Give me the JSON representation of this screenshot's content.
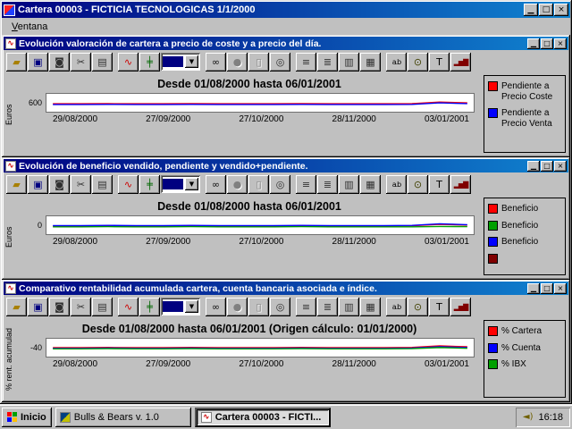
{
  "app": {
    "title": "Cartera 00003 - FICTICIA TECNOLOGICAS 1/1/2000",
    "menu": [
      {
        "label": "Ventana"
      }
    ]
  },
  "icons": {
    "minimize_glyph": "▁",
    "maximize_glyph": "□",
    "close_glyph": "×",
    "chart_window_glyph": "∿",
    "volume_glyph": "◄)",
    "dropdown_arrow_glyph": "▼"
  },
  "colors": {
    "titlebar_start": "#000080",
    "titlebar_end": "#1084d0",
    "chrome": "#c0c0c0",
    "series_red": "#ff0000",
    "series_blue": "#0000ff",
    "series_green": "#00a000"
  },
  "toolbar": {
    "buttons": [
      {
        "name": "open-button",
        "icon": "open-folder-icon",
        "glyph": "▰",
        "color": "#a88000"
      },
      {
        "name": "save-button",
        "icon": "save-floppy-icon",
        "glyph": "▣",
        "color": "#000080"
      },
      {
        "name": "snapshot-button",
        "icon": "camera-icon",
        "glyph": "◙",
        "color": "#303030"
      },
      {
        "name": "cut-button",
        "icon": "scissors-icon",
        "glyph": "✂",
        "color": "#303030"
      },
      {
        "name": "print-button",
        "icon": "printer-icon",
        "glyph": "▤",
        "color": "#303030",
        "gap": true
      },
      {
        "name": "line-chart-button",
        "icon": "line-chart-icon",
        "glyph": "∿",
        "color": "#cc0000"
      },
      {
        "name": "bar-chart-button",
        "icon": "candlestick-icon",
        "glyph": "╪",
        "color": "#006600"
      },
      {
        "type": "dropdown",
        "name": "series-selector-dropdown",
        "icon": "dropdown-arrow-icon",
        "fill": "#000080",
        "gap": true
      },
      {
        "name": "view-button",
        "icon": "glasses-icon",
        "glyph": "∞",
        "color": "#101010"
      },
      {
        "name": "pointer-button",
        "icon": "pointer-icon",
        "glyph": "●",
        "disabled": true
      },
      {
        "name": "region-button",
        "icon": "region-icon",
        "glyph": "▯",
        "disabled": true
      },
      {
        "name": "zoom-button",
        "icon": "magnifier-icon",
        "glyph": "◎",
        "color": "#303030",
        "gap": true
      },
      {
        "name": "report-list-button",
        "icon": "document-icon",
        "glyph": "≡",
        "color": "#303030"
      },
      {
        "name": "report-lines-button",
        "icon": "document-lines-icon",
        "glyph": "≣",
        "color": "#303030"
      },
      {
        "name": "report-table-button",
        "icon": "table-icon",
        "glyph": "▥",
        "color": "#303030"
      },
      {
        "name": "report-grid-button",
        "icon": "grid-icon",
        "glyph": "▦",
        "color": "#303030",
        "gap": true
      },
      {
        "name": "text-button",
        "icon": "ab-text-icon",
        "glyph": "a.b",
        "color": "#000000",
        "small": true
      },
      {
        "name": "find-button",
        "icon": "find-icon",
        "glyph": "⊙",
        "color": "#404000"
      },
      {
        "name": "title-button",
        "icon": "title-text-icon",
        "glyph": "T",
        "color": "#000000"
      },
      {
        "name": "histogram-button",
        "icon": "histogram-icon",
        "glyph": "▂▅▇",
        "color": "#800000",
        "small": true
      }
    ]
  },
  "windows": [
    {
      "title": "Evolución valoración de cartera a precio de coste y a precio del día."
    },
    {
      "title": "Evolución de beneficio vendido, pendiente y vendido+pendiente."
    },
    {
      "title": "Comparativo rentabilidad acumulada cartera, cuenta bancaria asociada e índice."
    }
  ],
  "chart_data": [
    {
      "type": "line",
      "title": "Desde 01/08/2000 hasta 06/01/2001",
      "ylabel": "Euros",
      "y_tick_label": "600",
      "ylim": [
        520,
        700
      ],
      "x_ticks": [
        "29/08/2000",
        "27/09/2000",
        "27/10/2000",
        "28/11/2000",
        "03/01/2001"
      ],
      "legend": [
        {
          "color": "#ff0000",
          "label": "Pendiente a Precio Coste"
        },
        {
          "color": "#0000ff",
          "label": "Pendiente a Precio Venta"
        }
      ],
      "series": [
        {
          "name": "Pendiente a Precio Coste",
          "color": "#ff0000",
          "values": [
            600,
            600,
            601,
            600,
            600,
            601,
            600,
            600,
            600,
            601,
            600,
            600,
            600,
            601,
            617,
            609
          ]
        },
        {
          "name": "Pendiente a Precio Venta",
          "color": "#0000ff",
          "values": [
            593,
            593,
            594,
            593,
            593,
            594,
            593,
            593,
            593,
            594,
            593,
            593,
            593,
            594,
            609,
            602
          ]
        }
      ]
    },
    {
      "type": "line",
      "title": "Desde 01/08/2000 hasta 06/01/2001",
      "ylabel": "Euros",
      "y_tick_label": "0",
      "ylim": [
        -40,
        60
      ],
      "x_ticks": [
        "29/08/2000",
        "27/09/2000",
        "27/10/2000",
        "28/11/2000",
        "03/01/2001"
      ],
      "legend": [
        {
          "color": "#ff0000",
          "label": "Beneficio"
        },
        {
          "color": "#00a000",
          "label": "Beneficio"
        },
        {
          "color": "#0000ff",
          "label": "Beneficio"
        },
        {
          "color": "#800000",
          "label": ""
        }
      ],
      "series": [
        {
          "name": "Beneficio",
          "color": "#ff0000",
          "values": [
            6,
            6,
            7,
            6,
            6,
            7,
            6,
            6,
            6,
            7,
            6,
            6,
            6,
            7,
            15,
            11
          ]
        },
        {
          "name": "Beneficio",
          "color": "#00a000",
          "values": [
            1,
            1,
            2,
            1,
            1,
            2,
            1,
            1,
            1,
            2,
            1,
            1,
            1,
            1,
            3,
            2
          ]
        },
        {
          "name": "Beneficio",
          "color": "#0000ff",
          "values": [
            8,
            8,
            9,
            8,
            8,
            9,
            8,
            8,
            8,
            9,
            8,
            8,
            8,
            9,
            18,
            13
          ]
        }
      ]
    },
    {
      "type": "line",
      "title": "Desde 01/08/2000 hasta 06/01/2001 (Origen cálculo: 01/01/2000)",
      "ylabel": "% rent. acumulad",
      "y_tick_label": "-40",
      "ylim": [
        -55,
        -25
      ],
      "x_ticks": [
        "29/08/2000",
        "27/09/2000",
        "27/10/2000",
        "28/11/2000",
        "03/01/2001"
      ],
      "legend": [
        {
          "color": "#ff0000",
          "label": "% Cartera"
        },
        {
          "color": "#0000ff",
          "label": "% Cuenta"
        },
        {
          "color": "#00a000",
          "label": "% IBX"
        }
      ],
      "series": [
        {
          "name": "% Cartera",
          "color": "#ff0000",
          "values": [
            -40,
            -40,
            -39.6,
            -40,
            -40,
            -39.6,
            -40,
            -40,
            -40,
            -39.6,
            -40,
            -40,
            -40,
            -39.6,
            -37,
            -38.5
          ]
        },
        {
          "name": "% Cuenta",
          "color": "#0000ff",
          "values": [
            -41,
            -41,
            -40.6,
            -41,
            -41,
            -40.6,
            -41,
            -41,
            -41,
            -40.6,
            -41,
            -41,
            -41,
            -40.6,
            -38.5,
            -39.8
          ]
        },
        {
          "name": "% IBX",
          "color": "#00a000",
          "values": [
            -42,
            -42,
            -41.6,
            -42,
            -42,
            -41.6,
            -42,
            -42,
            -42,
            -41.6,
            -42,
            -42,
            -42,
            -41.6,
            -39.8,
            -41
          ]
        }
      ]
    }
  ],
  "taskbar": {
    "start_label": "Inicio",
    "tasks": [
      "Bulls & Bears v. 1.0",
      "Cartera 00003 - FICTI..."
    ],
    "time": "16:18"
  }
}
